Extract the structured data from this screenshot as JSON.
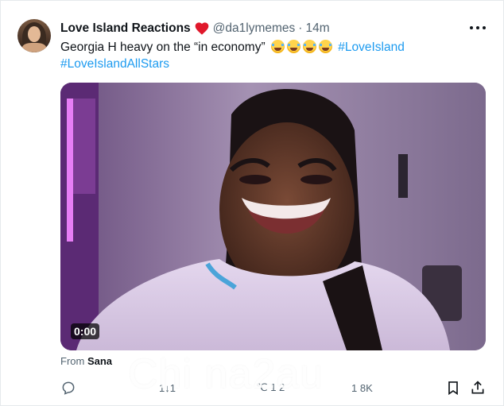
{
  "tweet": {
    "display_name": "Love Island Reactions",
    "handle": "@da1lymemes",
    "separator": "·",
    "time": "14m",
    "text_main": "Georgia H heavy on the “in economy”",
    "hashtags": [
      "#LoveIsland",
      "#LoveIslandAllStars"
    ],
    "emoji_count": 4,
    "emoji_name": "tears-of-joy"
  },
  "media": {
    "video_time": "0:00"
  },
  "source": {
    "prefix": "From",
    "name": "Sana"
  },
  "actions": {
    "reply_count": "",
    "retweet_count": "1↓1",
    "like_count": "℃ 1 2",
    "views_count": "1 8K"
  },
  "watermark": {
    "text": "Chi na2au"
  },
  "colors": {
    "link": "#1d9bf0",
    "muted": "#536471",
    "text": "#0f1419",
    "heart": "#f91880"
  }
}
